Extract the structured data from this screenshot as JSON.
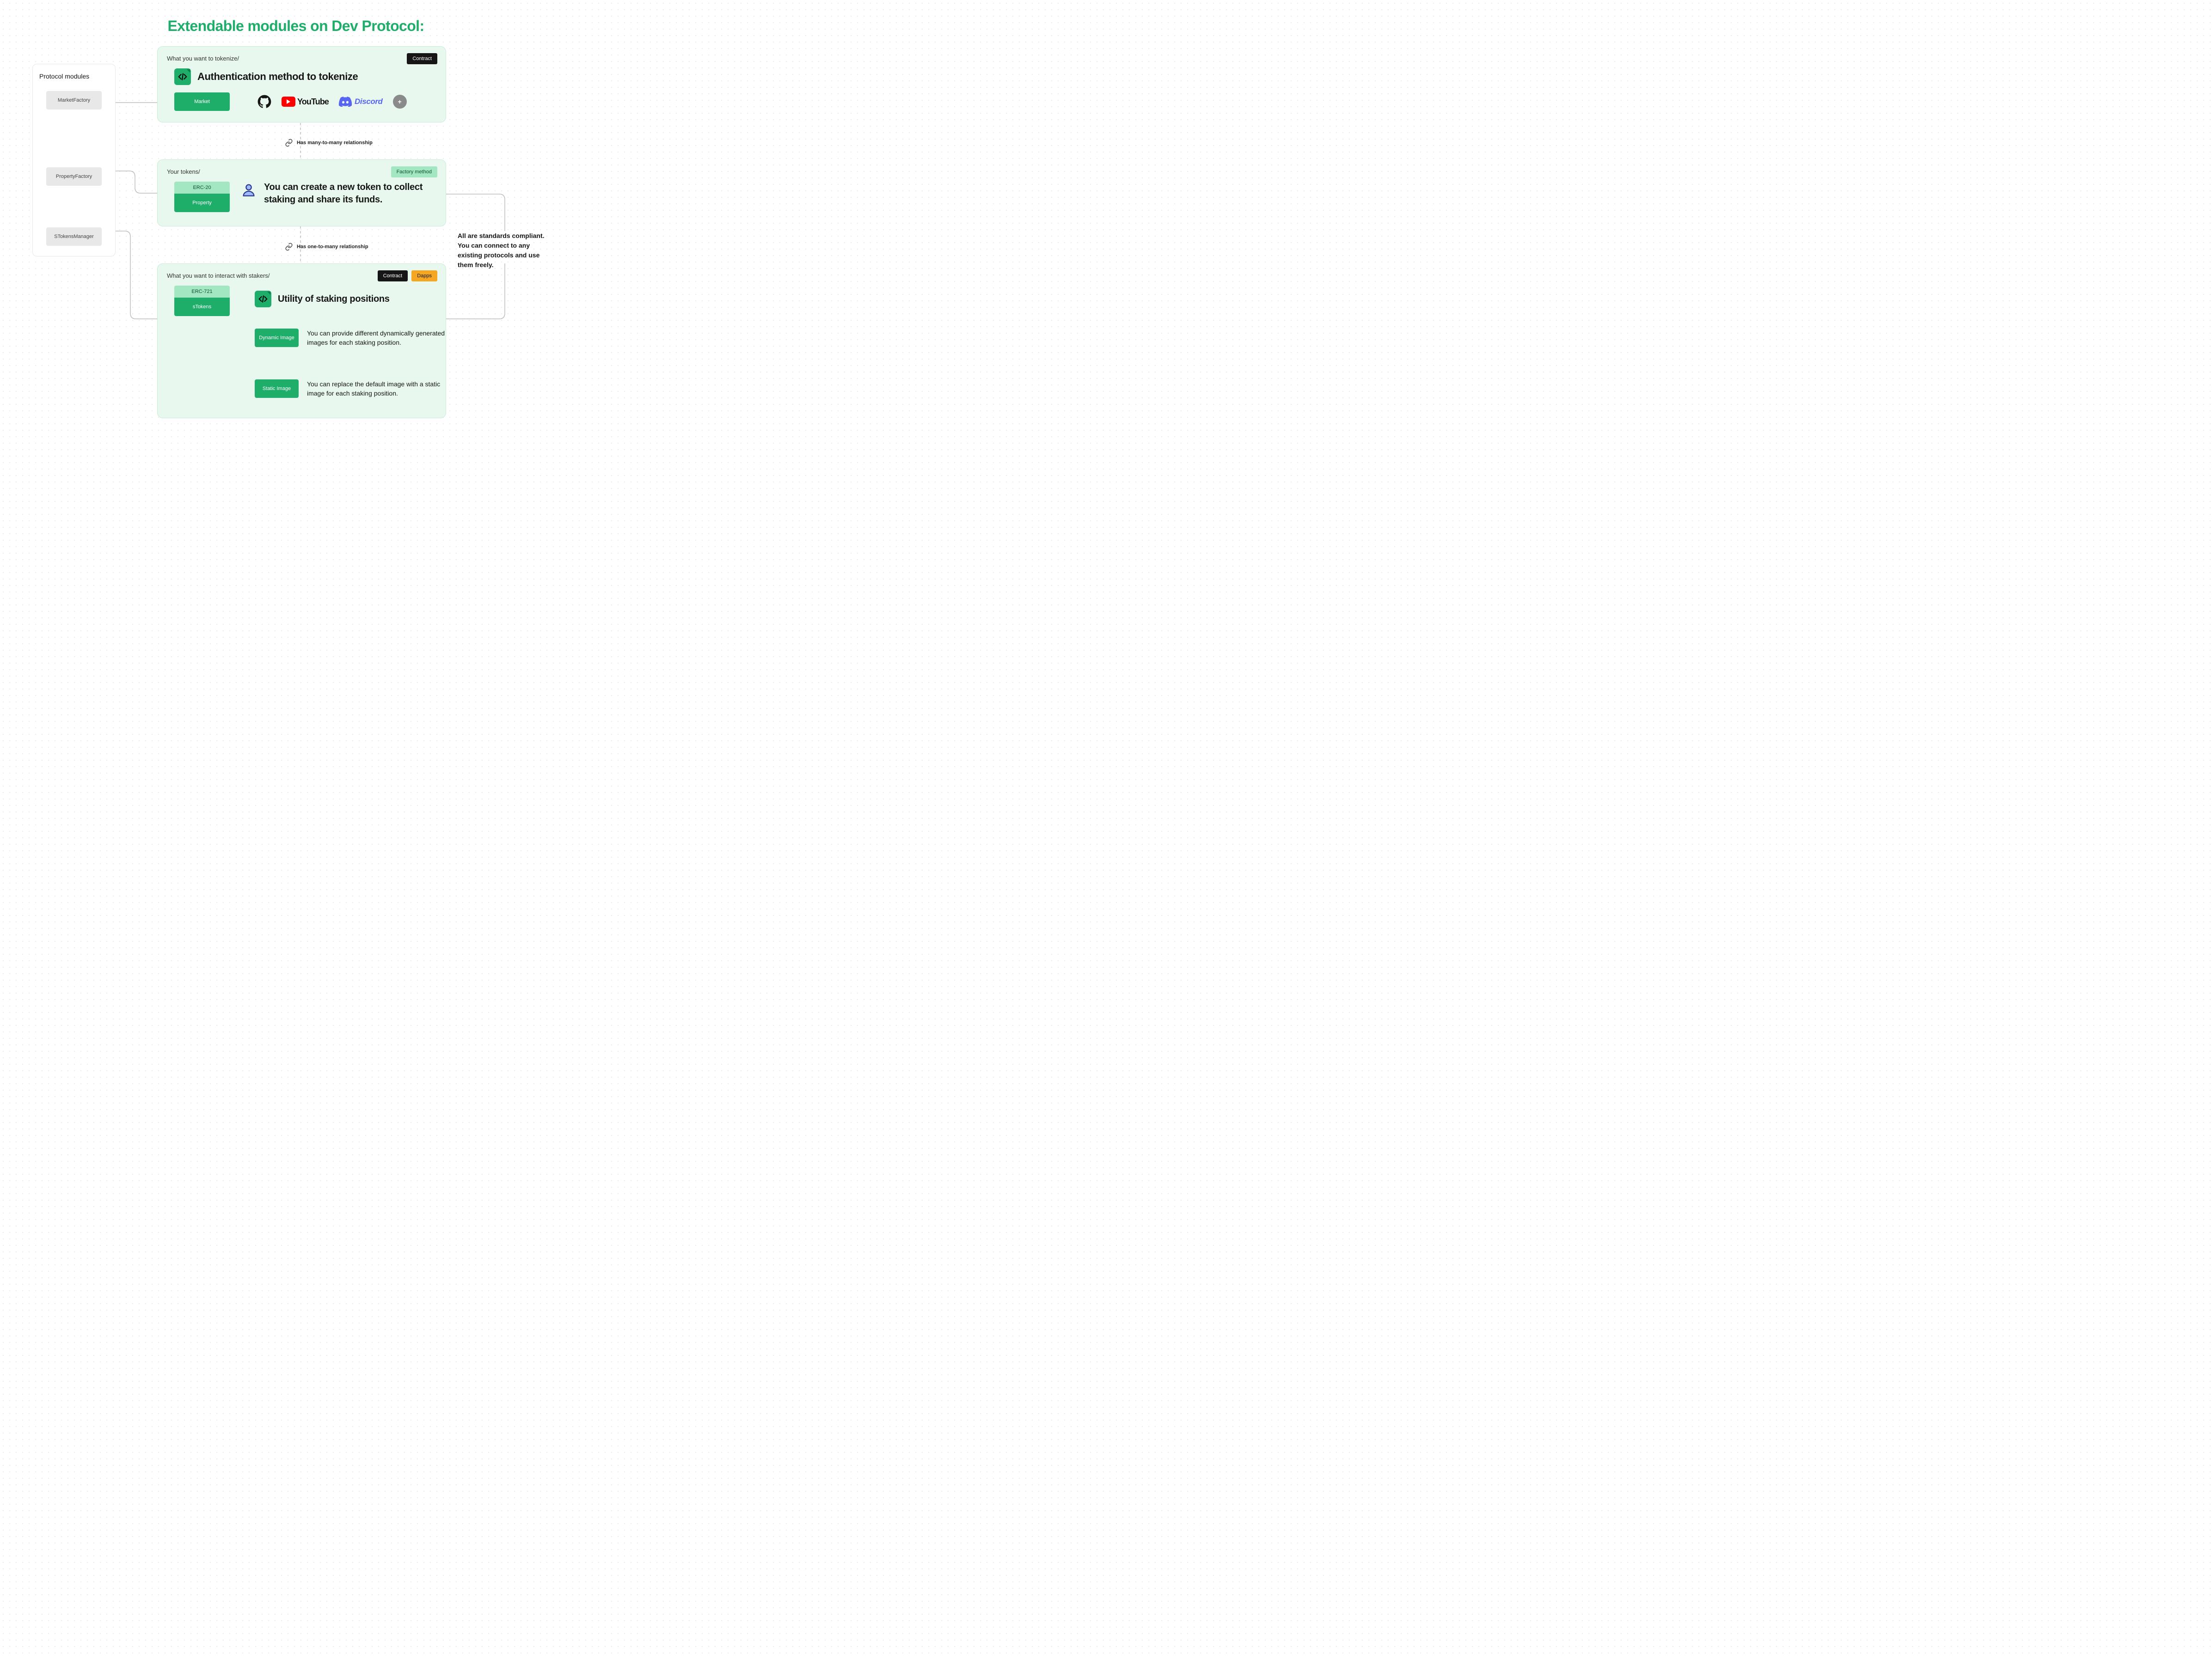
{
  "title": "Extendable modules on Dev Protocol:",
  "sidebar": {
    "title": "Protocol modules",
    "items": [
      "MarketFactory",
      "PropertyFactory",
      "STokensManager"
    ]
  },
  "relationships": {
    "r1": "Has many-to-many relationship",
    "r2": "Has one-to-many relationship"
  },
  "card1": {
    "path": "What you want to tokenize/",
    "tag": "Contract",
    "heading": "Authentication method to tokenize",
    "button": "Market",
    "brands": {
      "youtube": "YouTube",
      "discord": "Discord",
      "plus": "+"
    }
  },
  "card2": {
    "path": "Your tokens/",
    "tag": "Factory method",
    "erc": "ERC-20",
    "button": "Property",
    "heading": "You can create a new token to collect staking and share its funds."
  },
  "card3": {
    "path": "What you want to interact with stakers/",
    "tag1": "Contract",
    "tag2": "Dapps",
    "erc": "ERC-721",
    "button": "sTokens",
    "heading": "Utility of staking positions",
    "sub1": {
      "label": "Dynamic Image",
      "desc": "You can provide different dynamically generated images for each staking position."
    },
    "sub2": {
      "label": "Static Image",
      "desc": "You can replace the default image with a static image for each staking position."
    }
  },
  "annotation": "All are standards compliant. You can connect to any existing protocols and use them freely."
}
